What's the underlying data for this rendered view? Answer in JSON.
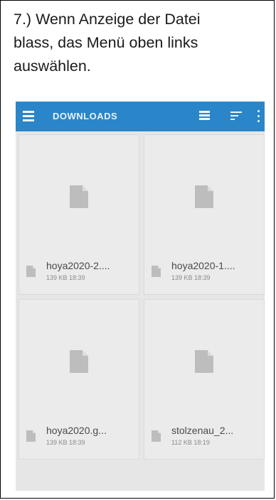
{
  "instruction": {
    "line1": "7.) Wenn Anzeige der Datei",
    "line2": "blass, das Menü oben links",
    "line3": "auswählen."
  },
  "app": {
    "title": "DOWNLOADS",
    "accent": "#2a86c8",
    "icons": {
      "menu": "menu-icon",
      "view": "list-view-icon",
      "sort": "sort-icon",
      "more": "more-vert-icon"
    }
  },
  "files": [
    {
      "name": "hoya2020-2....",
      "meta": "139 KB 18:39"
    },
    {
      "name": "hoya2020-1....",
      "meta": "139 KB 18:39"
    },
    {
      "name": "hoya2020.g...",
      "meta": "139 KB 18:39"
    },
    {
      "name": "stolzenau_2...",
      "meta": "112 KB 18:19"
    }
  ]
}
